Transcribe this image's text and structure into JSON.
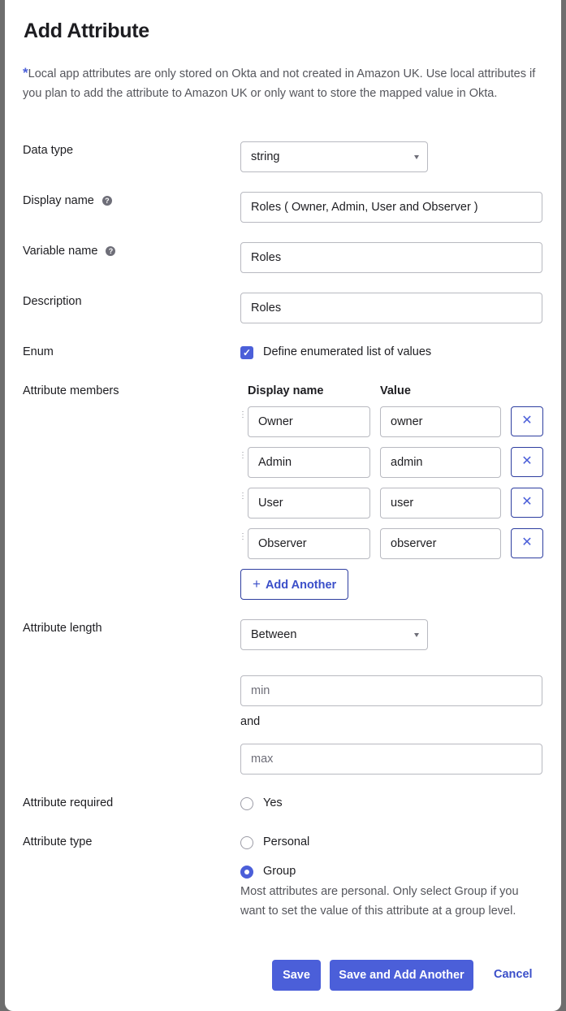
{
  "modal": {
    "title": "Add Attribute",
    "note_star": "*",
    "note": "Local app attributes are only stored on Okta and not created in Amazon UK. Use local attributes if you plan to add the attribute to Amazon UK or only want to store the mapped value in Okta."
  },
  "fields": {
    "data_type": {
      "label": "Data type",
      "value": "string"
    },
    "display_name": {
      "label": "Display name",
      "value": "Roles ( Owner, Admin, User and Observer )"
    },
    "variable_name": {
      "label": "Variable name",
      "value": "Roles"
    },
    "description": {
      "label": "Description",
      "value": "Roles"
    },
    "enum": {
      "label": "Enum",
      "checkbox_label": "Define enumerated list of values",
      "checked": true
    },
    "attribute_members": {
      "label": "Attribute members",
      "col_display": "Display name",
      "col_value": "Value",
      "rows": [
        {
          "display": "Owner",
          "value": "owner"
        },
        {
          "display": "Admin",
          "value": "admin"
        },
        {
          "display": "User",
          "value": "user"
        },
        {
          "display": "Observer",
          "value": "observer"
        }
      ],
      "add_label": "Add Another"
    },
    "attribute_length": {
      "label": "Attribute length",
      "value": "Between",
      "min_placeholder": "min",
      "and": "and",
      "max_placeholder": "max"
    },
    "attribute_required": {
      "label": "Attribute required",
      "option": "Yes",
      "checked": false
    },
    "attribute_type": {
      "label": "Attribute type",
      "options": [
        "Personal",
        "Group"
      ],
      "selected": "Group",
      "help": "Most attributes are personal. Only select Group if you want to set the value of this attribute at a group level."
    }
  },
  "footer": {
    "save": "Save",
    "save_add": "Save and Add Another",
    "cancel": "Cancel"
  },
  "icons": {
    "help": "question-circle-icon",
    "remove": "close-icon",
    "add": "plus-icon",
    "drag": "drag-handle-icon",
    "caret": "chevron-down-icon",
    "check": "checkmark-icon"
  },
  "colors": {
    "accent": "#4b5fd9",
    "border_dark": "#2e3ea0",
    "text": "#1d1d21",
    "muted": "#55565c"
  }
}
